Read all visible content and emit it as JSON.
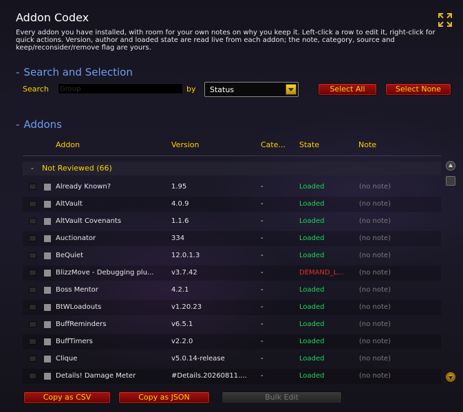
{
  "window": {
    "title": "Addon Codex",
    "description": "Every addon you have installed, with room for your own notes on why you keep it. Left-click a row to edit it, right-click for quick actions. Version, author and loaded state are read live from each addon; the note, category, source and keep/reconsider/remove flag are yours.",
    "expand_icon": "expand-arrows-icon"
  },
  "search_section": {
    "header": "Search and Selection",
    "search_label": "Search",
    "search_value": "",
    "search_placeholder": "Group",
    "group_by_label": "by",
    "group_by_value": "Status",
    "select_all": "Select All",
    "select_none": "Select None"
  },
  "addons_section": {
    "header": "Addons",
    "columns": {
      "addon": "Addon",
      "version": "Version",
      "category": "Cate...",
      "state": "State",
      "note": "Note"
    },
    "group": {
      "label": "Not Reviewed (66)"
    },
    "rows": [
      {
        "name": "Already Known?",
        "version": "1.95",
        "category": "-",
        "state": "Loaded",
        "note": "(no note)"
      },
      {
        "name": "AltVault",
        "version": "4.0.9",
        "category": "-",
        "state": "Loaded",
        "note": "(no note)"
      },
      {
        "name": "AltVault Covenants",
        "version": "1.1.6",
        "category": "-",
        "state": "Loaded",
        "note": "(no note)"
      },
      {
        "name": "Auctionator",
        "version": "334",
        "category": "-",
        "state": "Loaded",
        "note": "(no note)"
      },
      {
        "name": "BeQuiet",
        "version": "12.0.1.3",
        "category": "-",
        "state": "Loaded",
        "note": "(no note)"
      },
      {
        "name": "BlizzMove - Debugging plu...",
        "version": "v3.7.42",
        "category": "-",
        "state": "DEMAND_L...",
        "note": "(no note)"
      },
      {
        "name": "Boss Mentor",
        "version": "4.2.1",
        "category": "-",
        "state": "Loaded",
        "note": "(no note)"
      },
      {
        "name": "BtWLoadouts",
        "version": "v1.20.23",
        "category": "-",
        "state": "Loaded",
        "note": "(no note)"
      },
      {
        "name": "BuffReminders",
        "version": "v6.5.1",
        "category": "-",
        "state": "Loaded",
        "note": "(no note)"
      },
      {
        "name": "BuffTimers",
        "version": "v2.2.0",
        "category": "-",
        "state": "Loaded",
        "note": "(no note)"
      },
      {
        "name": "Clique",
        "version": "v5.0.14-release",
        "category": "-",
        "state": "Loaded",
        "note": "(no note)"
      },
      {
        "name": "Details! Damage Meter",
        "version": "#Details.20260811....",
        "category": "-",
        "state": "Loaded",
        "note": "(no note)"
      }
    ]
  },
  "footer": {
    "copy_csv": "Copy as CSV",
    "copy_json": "Copy as JSON",
    "bulk_edit": "Bulk Edit"
  },
  "colors": {
    "title_gold": "#ffd200",
    "section_blue": "#6f9df0",
    "state_loaded": "#1fd35a",
    "state_demand": "#e0302a",
    "note_gray": "#7a7a7a"
  }
}
